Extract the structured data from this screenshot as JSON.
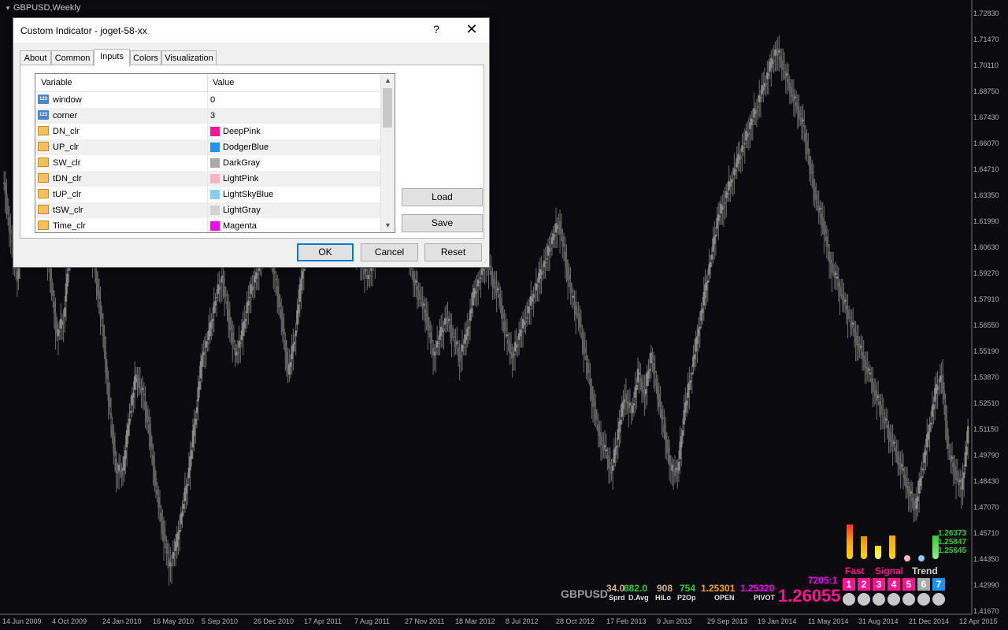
{
  "chart_window": {
    "title": "GBPUSD,Weekly",
    "y_ticks": [
      "1.72830",
      "1.71470",
      "1.70110",
      "1.68750",
      "1.67430",
      "1.66070",
      "1.64710",
      "1.63350",
      "1.61990",
      "1.60630",
      "1.59270",
      "1.57910",
      "1.56550",
      "1.55190",
      "1.53870",
      "1.52510",
      "1.51150",
      "1.49790",
      "1.48430",
      "1.47070",
      "1.45710",
      "1.44350",
      "1.42990",
      "1.41670"
    ],
    "x_ticks": [
      "14 Jun 2009",
      "4 Oct 2009",
      "24 Jan 2010",
      "16 May 2010",
      "5 Sep 2010",
      "26 Dec 2010",
      "17 Apr 2011",
      "7 Aug 2011",
      "27 Nov 2011",
      "18 Mar 2012",
      "8 Jul 2012",
      "28 Oct 2012",
      "17 Feb 2013",
      "9 Jun 2013",
      "29 Sep 2013",
      "19 Jan 2014",
      "11 May 2014",
      "31 Aug 2014",
      "21 Dec 2014",
      "12 Apr 2015"
    ]
  },
  "chart_data": {
    "type": "candlestick",
    "symbol": "GBPUSD",
    "timeframe": "Weekly",
    "x_range": [
      "14 Jun 2009",
      "12 Apr 2015"
    ],
    "ylim": [
      1.4167,
      1.7283
    ],
    "closes": [
      1.64,
      1.61,
      1.59,
      1.63,
      1.66,
      1.64,
      1.62,
      1.59,
      1.56,
      1.57,
      1.61,
      1.63,
      1.63,
      1.61,
      1.59,
      1.56,
      1.52,
      1.49,
      1.49,
      1.52,
      1.54,
      1.53,
      1.51,
      1.48,
      1.46,
      1.44,
      1.45,
      1.47,
      1.49,
      1.52,
      1.55,
      1.56,
      1.58,
      1.59,
      1.57,
      1.55,
      1.56,
      1.58,
      1.59,
      1.6,
      1.61,
      1.59,
      1.57,
      1.54,
      1.56,
      1.59,
      1.61,
      1.63,
      1.64,
      1.64,
      1.62,
      1.63,
      1.62,
      1.61,
      1.6,
      1.59,
      1.6,
      1.62,
      1.63,
      1.64,
      1.62,
      1.61,
      1.59,
      1.58,
      1.57,
      1.55,
      1.56,
      1.57,
      1.56,
      1.55,
      1.56,
      1.58,
      1.59,
      1.6,
      1.59,
      1.58,
      1.56,
      1.55,
      1.56,
      1.57,
      1.58,
      1.59,
      1.6,
      1.61,
      1.62,
      1.6,
      1.58,
      1.57,
      1.55,
      1.53,
      1.51,
      1.5,
      1.49,
      1.51,
      1.53,
      1.52,
      1.54,
      1.53,
      1.55,
      1.53,
      1.51,
      1.49,
      1.49,
      1.52,
      1.54,
      1.56,
      1.58,
      1.6,
      1.62,
      1.63,
      1.64,
      1.65,
      1.66,
      1.67,
      1.68,
      1.69,
      1.7,
      1.71,
      1.7,
      1.69,
      1.68,
      1.67,
      1.65,
      1.63,
      1.62,
      1.6,
      1.59,
      1.58,
      1.57,
      1.56,
      1.55,
      1.54,
      1.53,
      1.52,
      1.51,
      1.5,
      1.49,
      1.48,
      1.47,
      1.49,
      1.51,
      1.53,
      1.54,
      1.5,
      1.49,
      1.48,
      1.51
    ]
  },
  "dialog": {
    "title": "Custom Indicator - joget-58-xx",
    "help": "?",
    "close": "✕",
    "tabs": [
      "About",
      "Common",
      "Inputs",
      "Colors",
      "Visualization"
    ],
    "col_variable": "Variable",
    "col_value": "Value",
    "rows": [
      {
        "name": "window",
        "type": "num",
        "value": "0"
      },
      {
        "name": "corner",
        "type": "num",
        "value": "3"
      },
      {
        "name": "DN_clr",
        "type": "clr",
        "value": "DeepPink",
        "color": "#ff1493"
      },
      {
        "name": "UP_clr",
        "type": "clr",
        "value": "DodgerBlue",
        "color": "#1e90ff"
      },
      {
        "name": "SW_clr",
        "type": "clr",
        "value": "DarkGray",
        "color": "#a9a9a9"
      },
      {
        "name": "tDN_clr",
        "type": "clr",
        "value": "LightPink",
        "color": "#ffb6c1"
      },
      {
        "name": "tUP_clr",
        "type": "clr",
        "value": "LightSkyBlue",
        "color": "#87cefa"
      },
      {
        "name": "tSW_clr",
        "type": "clr",
        "value": "LightGray",
        "color": "#d3d3d3"
      },
      {
        "name": "Time_clr",
        "type": "clr",
        "value": "Magenta",
        "color": "#ff00ff"
      }
    ],
    "load": "Load",
    "save": "Save",
    "ok": "OK",
    "cancel": "Cancel",
    "reset": "Reset"
  },
  "panel": {
    "symbol": "GBPUSD",
    "spread": "34.0",
    "d_avg": "882.0",
    "spread_label": "Sprd",
    "davg_label": "D.Avg",
    "hilo": "908",
    "hilo_label": "HiLo",
    "p2op": "754",
    "p2op_label": "P2Op",
    "open": "1.25301",
    "open_label": "OPEN",
    "pivot": "1.25320",
    "pivot_label": "PIVOT",
    "price": "1.26055",
    "time": "7205:1",
    "fast_label": "Fast",
    "signal_label": "Signal",
    "trend_label": "Trend",
    "numbers": [
      "1",
      "2",
      "3",
      "4",
      "5",
      "6",
      "7"
    ],
    "level1": "1.26373",
    "level2": "1.25847",
    "level3": "1.25645"
  }
}
